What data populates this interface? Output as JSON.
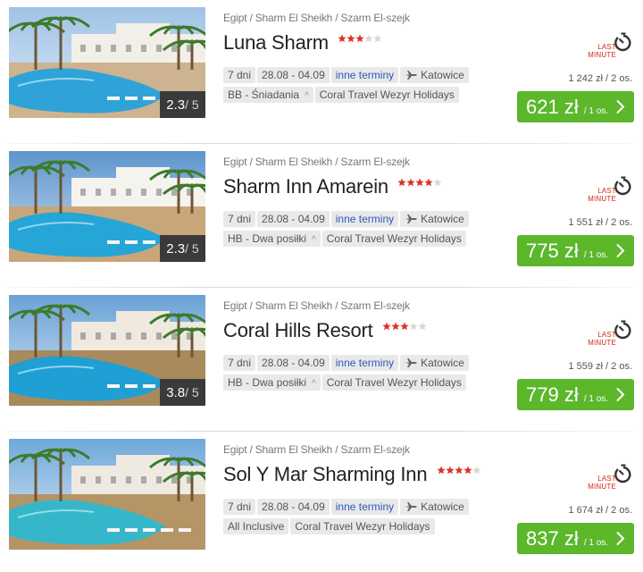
{
  "offers": [
    {
      "breadcrumb": "Egipt / Sharm El Sheikh / Szarm El-szejk",
      "name": "Luna Sharm",
      "stars": 3,
      "rating": "2.3",
      "rating_scale": "/ 5",
      "duration": "7 dni",
      "dates": "28.08 - 04.09",
      "other_dates": "inne terminy",
      "departure": "Katowice",
      "board": "BB - Śniadania",
      "operator": "Coral Travel Wezyr Holidays",
      "last_minute": [
        "LAST",
        "MINUTE"
      ],
      "price_two": "1 242 zł / 2 os.",
      "price": "621 zł",
      "price_per": "/ 1 os.",
      "board_has_caret": true
    },
    {
      "breadcrumb": "Egipt / Sharm El Sheikh / Szarm El-szejk",
      "name": "Sharm Inn Amarein",
      "stars": 4,
      "rating": "2.3",
      "rating_scale": "/ 5",
      "duration": "7 dni",
      "dates": "28.08 - 04.09",
      "other_dates": "inne terminy",
      "departure": "Katowice",
      "board": "HB - Dwa posiłki",
      "operator": "Coral Travel Wezyr Holidays",
      "last_minute": [
        "LAST",
        "MINUTE"
      ],
      "price_two": "1 551 zł / 2 os.",
      "price": "775 zł",
      "price_per": "/ 1 os.",
      "board_has_caret": true
    },
    {
      "breadcrumb": "Egipt / Sharm El Sheikh / Szarm El-szejk",
      "name": "Coral Hills Resort",
      "stars": 3,
      "rating": "3.8",
      "rating_scale": "/ 5",
      "duration": "7 dni",
      "dates": "28.08 - 04.09",
      "other_dates": "inne terminy",
      "departure": "Katowice",
      "board": "HB - Dwa posiłki",
      "operator": "Coral Travel Wezyr Holidays",
      "last_minute": [
        "LAST",
        "MINUTE"
      ],
      "price_two": "1 559 zł / 2 os.",
      "price": "779 zł",
      "price_per": "/ 1 os.",
      "board_has_caret": true
    },
    {
      "breadcrumb": "Egipt / Sharm El Sheikh / Szarm El-szejk",
      "name": "Sol Y Mar Sharming Inn",
      "stars": 4,
      "rating": "",
      "rating_scale": "",
      "duration": "7 dni",
      "dates": "28.08 - 04.09",
      "other_dates": "inne terminy",
      "departure": "Katowice",
      "board": "All Inclusive",
      "operator": "Coral Travel Wezyr Holidays",
      "last_minute": [
        "LAST",
        "MINUTE"
      ],
      "price_two": "1 674 zł / 2 os.",
      "price": "837 zł",
      "price_per": "/ 1 os.",
      "board_has_caret": false
    }
  ],
  "icons": {
    "plane": "plane-icon",
    "timer": "stopwatch-icon",
    "chevron": "chevron-right-icon",
    "star": "star-icon"
  },
  "colors": {
    "price_button": "#5cb72b",
    "last_minute": "#d0281c",
    "star_filled": "#d9342b",
    "star_empty": "#d8d8d8",
    "link": "#2b58b8"
  }
}
